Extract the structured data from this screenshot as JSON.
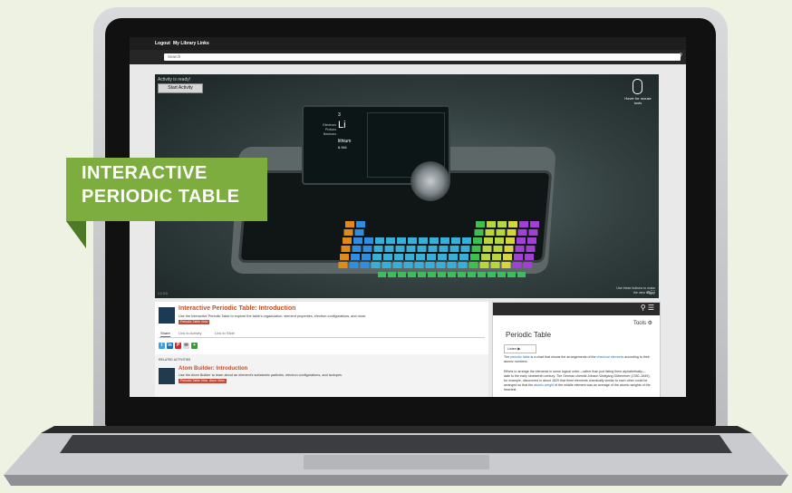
{
  "colors": {
    "background": "#eef2e3",
    "banner": "#7cad3e",
    "accent_title": "#c2502a",
    "tag": "#c54a39"
  },
  "banner": {
    "line1": "INTERACTIVE",
    "line2": "PERIODIC TABLE"
  },
  "topbar": {
    "logout": "Logout",
    "my_library": "My Library Links"
  },
  "search": {
    "placeholder": "Search",
    "icon": "search-icon"
  },
  "simulation": {
    "ready": "Activity is ready!",
    "start": "Start Activity",
    "mouse_hint": "Hover for mouse tools",
    "corner_hint": "Use these buttons to make the view bigger",
    "version": "1.2.3.0",
    "element_symbol": "Li",
    "element_name": "lithium",
    "element_number": "3",
    "element_mass": "6.941",
    "element_counts": [
      "Electrons",
      "Protons",
      "Neutrons"
    ]
  },
  "activity": {
    "title": "Interactive Periodic Table: Introduction",
    "desc": "Use the Interactive Periodic Table to explore the table's organization, element properties, electron configurations, and more.",
    "tag": "Periodic Table View",
    "tabs": [
      "Share",
      "Link to Activity",
      "Link to Slide"
    ],
    "share_icons": [
      "twitter-icon",
      "linkedin-icon",
      "pinterest-icon",
      "email-icon",
      "google-classroom-icon"
    ]
  },
  "related": {
    "heading": "RELATED ACTIVITIES",
    "title": "Atom Builder: Introduction",
    "desc": "Use the Atom Builder to learn about an element's subatomic particles, electron configurations, and isotopes.",
    "tags": [
      "Periodic Table View",
      "Atom View"
    ]
  },
  "panel": {
    "tools": "Tools",
    "title": "Periodic Table",
    "listen": "Listen",
    "p1_pre": "The",
    "p1_link": "periodic table",
    "p1_post": "is a chart that shows the arrangements of the",
    "p1_link2": "chemical elements",
    "p1_end": "according to their atomic numbers.",
    "p2": "Efforts to arrange the elements in some logical order—rather than just listing them alphabetically—date to the early nineteenth century. The German chemist Johann Wolfgang Döbereiner (1780–1849), for example, discovered in about 1829 that three elements chemically similar to each other could be arranged so that the",
    "p2_link": "atomic weight",
    "p2_end": "of the middle element was an average of the atomic weights of the heaviest"
  }
}
